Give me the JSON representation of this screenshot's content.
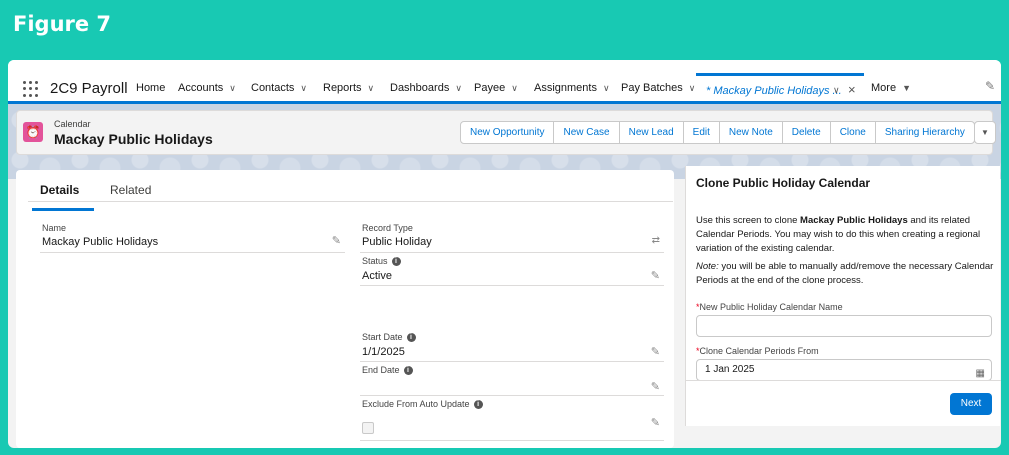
{
  "figure_title": "Figure 7",
  "app_name": "2C9 Payroll",
  "nav": {
    "items": [
      {
        "label": "Home"
      },
      {
        "label": "Accounts"
      },
      {
        "label": "Contacts"
      },
      {
        "label": "Reports"
      },
      {
        "label": "Dashboards"
      },
      {
        "label": "Payee"
      },
      {
        "label": "Assignments"
      },
      {
        "label": "Pay Batches"
      }
    ],
    "active_tab": "* Mackay Public Holidays ...",
    "more_label": "More"
  },
  "record": {
    "object_type": "Calendar",
    "name": "Mackay Public Holidays",
    "actions": [
      "New Opportunity",
      "New Case",
      "New Lead",
      "Edit",
      "New Note",
      "Delete",
      "Clone",
      "Sharing Hierarchy"
    ]
  },
  "tabs": {
    "details": "Details",
    "related": "Related"
  },
  "fields": {
    "name": {
      "label": "Name",
      "value": "Mackay Public Holidays"
    },
    "record_type": {
      "label": "Record Type",
      "value": "Public Holiday"
    },
    "status": {
      "label": "Status",
      "value": "Active"
    },
    "start_date": {
      "label": "Start Date",
      "value": "1/1/2025"
    },
    "end_date": {
      "label": "End Date",
      "value": ""
    },
    "exclude": {
      "label": "Exclude From Auto Update",
      "checked": false
    }
  },
  "clone_panel": {
    "title": "Clone Public Holiday Calendar",
    "desc_before": "Use this screen to clone ",
    "desc_bold": "Mackay Public Holidays",
    "desc_after": " and its related Calendar Periods. You may wish to do this when creating a regional variation of the existing calendar.",
    "note_label": "Note:",
    "note_text": " you will be able to manually add/remove the necessary Calendar Periods at the end of the clone process.",
    "name_label": "New Public Holiday Calendar Name",
    "name_value": "",
    "from_label": "Clone Calendar Periods From",
    "from_value": "1 Jan 2025",
    "next_label": "Next"
  },
  "colors": {
    "brand_blue": "#0176d3",
    "teal_background": "#18c9b3",
    "calendar_icon": "#e3539a"
  }
}
